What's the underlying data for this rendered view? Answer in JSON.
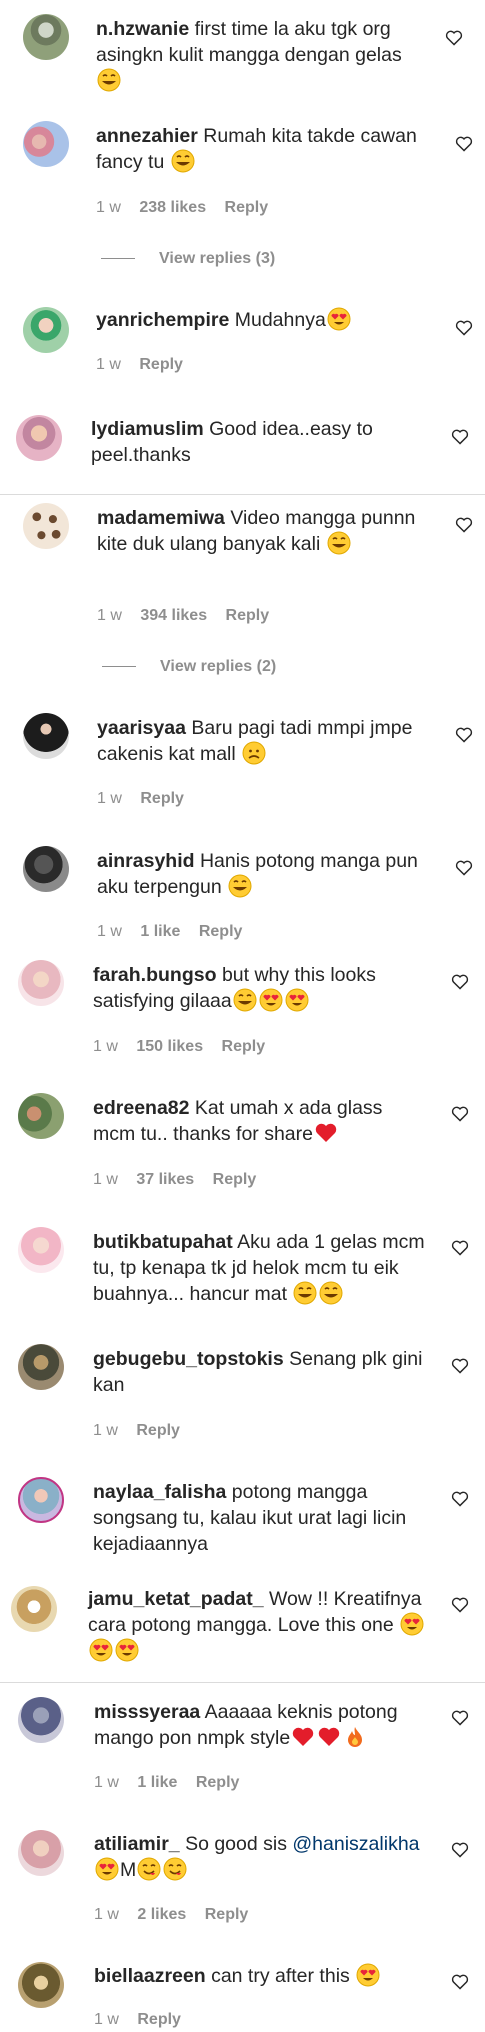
{
  "comments": [
    {
      "user": "n.hzwanie",
      "text": "first time la aku tgk org asingkn kulit mangga dengan gelas",
      "emojis": [
        "grin"
      ]
    },
    {
      "user": "annezahier",
      "text": "Rumah kita takde cawan fancy tu",
      "emojis": [
        "grin"
      ],
      "time": "1 w",
      "likes": "238 likes",
      "reply": "Reply",
      "view_replies": "View replies (3)"
    },
    {
      "user": "yanrichempire",
      "text": "Mudahnya",
      "emojis": [
        "heart-eyes"
      ],
      "time": "1 w",
      "reply": "Reply"
    },
    {
      "user": "lydiamuslim",
      "text": "Good idea..easy to peel.thanks"
    },
    {
      "user": "madamemiwa",
      "text": "Video mangga punnn kite duk ulang banyak kali",
      "emojis": [
        "grin"
      ],
      "time": "1 w",
      "likes": "394 likes",
      "reply": "Reply",
      "view_replies": "View replies (2)"
    },
    {
      "user": "yaarisyaa",
      "text": "Baru pagi tadi mmpi jmpe cakenis kat mall",
      "emojis": [
        "sad"
      ],
      "time": "1 w",
      "reply": "Reply"
    },
    {
      "user": "ainrasyhid",
      "text": "Hanis potong manga pun aku terpengun",
      "emojis": [
        "grin"
      ],
      "time": "1 w",
      "likes": "1 like",
      "reply": "Reply"
    },
    {
      "user": "farah.bungso",
      "text": "but why this looks satisfying gilaaa",
      "emojis": [
        "grin",
        "heart-eyes",
        "heart-eyes"
      ],
      "time": "1 w",
      "likes": "150 likes",
      "reply": "Reply"
    },
    {
      "user": "edreena82",
      "text": "Kat umah x ada glass mcm tu.. thanks for share",
      "emojis": [
        "red-heart"
      ],
      "time": "1 w",
      "likes": "37 likes",
      "reply": "Reply"
    },
    {
      "user": "butikbatupahat",
      "text": "Aku ada 1 gelas mcm tu, tp kenapa tk jd helok mcm tu eik buahnya... hancur mat",
      "emojis": [
        "grin",
        "grin"
      ]
    },
    {
      "user": "gebugebu_topstokis",
      "text": "Senang plk gini kan",
      "time": "1 w",
      "reply": "Reply"
    },
    {
      "user": "naylaa_falisha",
      "text": "potong mangga songsang tu, kalau ikut urat lagi licin kejadiaannya"
    },
    {
      "user": "jamu_ketat_padat_",
      "text": "Wow !! Kreatifnya cara potong mangga. Love this one",
      "emojis": [
        "heart-eyes",
        "heart-eyes",
        "heart-eyes"
      ]
    },
    {
      "user": "misssyeraa",
      "text": "Aaaaaa keknis potong mango pon nmpk style",
      "emojis": [
        "red-heart",
        "red-heart",
        "fire"
      ],
      "time": "1 w",
      "likes": "1 like",
      "reply": "Reply"
    },
    {
      "user": "atiliamir_",
      "text": "So good sis",
      "mention": "@haniszalikha",
      "emojis": [
        "heart-eyes",
        "M",
        "savoring",
        "savoring"
      ],
      "time": "1 w",
      "likes": "2 likes",
      "reply": "Reply"
    },
    {
      "user": "biellaazreen",
      "text": "can try after this",
      "emojis": [
        "heart-eyes"
      ],
      "time": "1 w",
      "reply": "Reply"
    }
  ],
  "colors": {
    "text": "#262626",
    "secondary": "#8e8e8e",
    "mention": "#00376b",
    "heart_icon": "#262626"
  }
}
